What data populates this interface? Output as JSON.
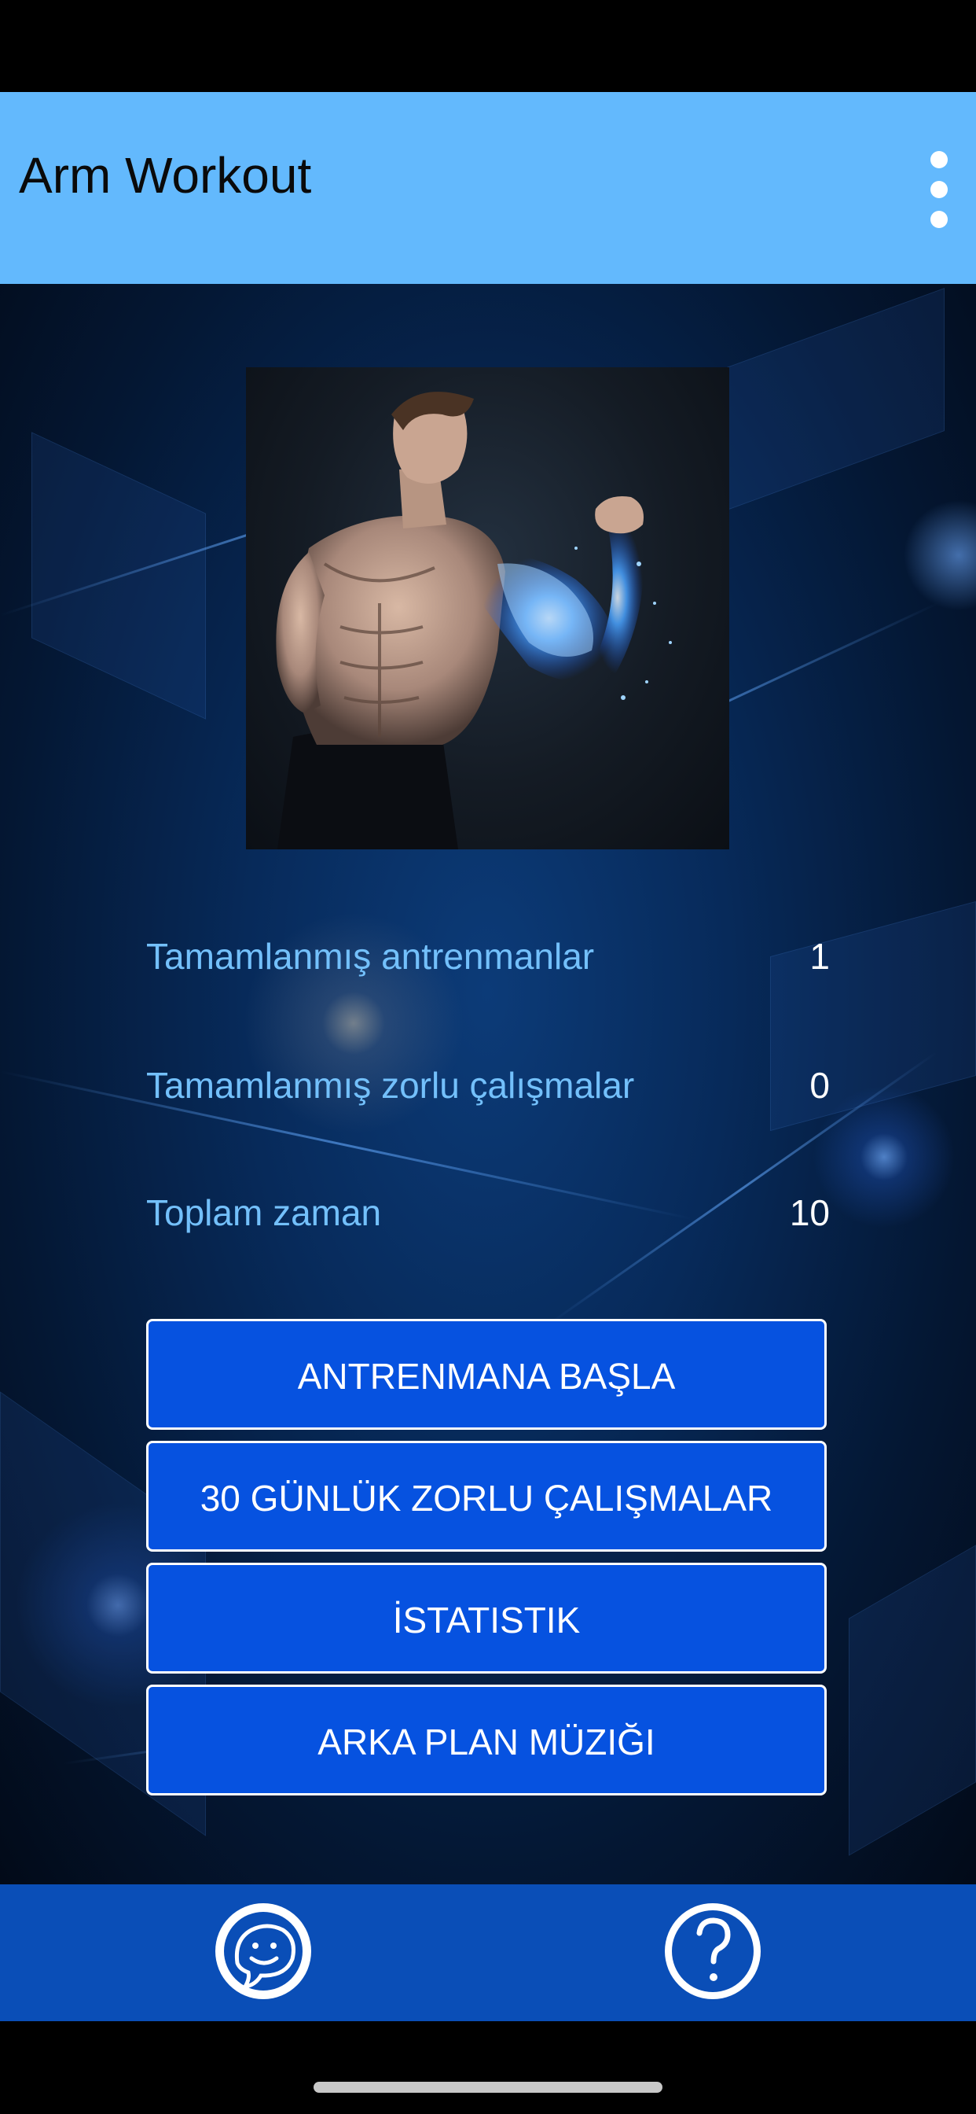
{
  "app_bar": {
    "title": "Arm Workout",
    "menu_icon": "more-vertical-icon"
  },
  "hero": {
    "image_icon": "flexing-man-photo"
  },
  "stats": [
    {
      "label": "Tamamlanmış antrenmanlar",
      "value": "1"
    },
    {
      "label": "Tamamlanmış zorlu çalışmalar",
      "value": "0"
    },
    {
      "label": "Toplam zaman",
      "value": "10"
    }
  ],
  "buttons": {
    "start": "ANTRENMANA BAŞLA",
    "challenge": "30 GÜNLÜK ZORLU ÇALIŞMALAR",
    "stats": "İSTATISTIK",
    "music": "ARKA PLAN MÜZIĞI"
  },
  "bottom_bar": {
    "feedback_icon": "chat-smiley-icon",
    "help_icon": "question-mark-icon"
  },
  "colors": {
    "app_bar": "#63b9fd",
    "stat_label": "#73c0fb",
    "button": "#0652e0",
    "bottom_bar": "#0a4eb7"
  }
}
